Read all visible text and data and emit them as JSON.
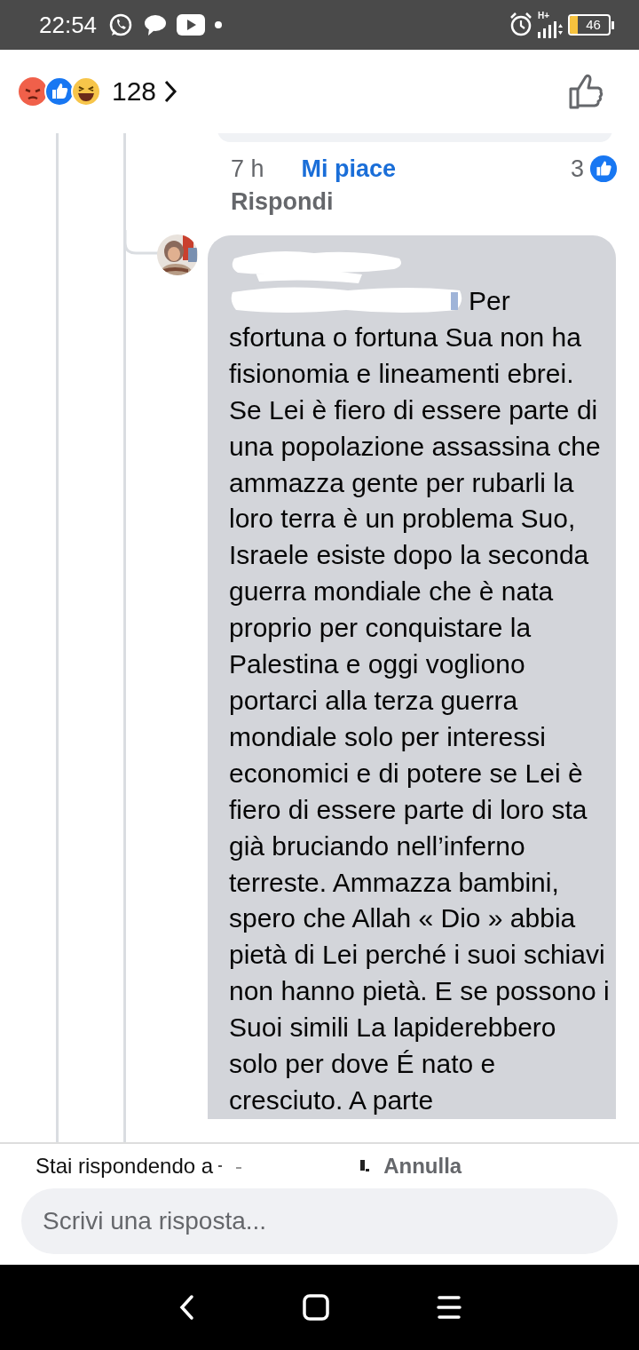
{
  "status_bar": {
    "time": "22:54",
    "network": "H+",
    "battery": "46"
  },
  "header": {
    "reaction_count": "128"
  },
  "previous_comment": {
    "time": "7 h",
    "like_action": "Mi piace",
    "reply_action": "Rispondi",
    "like_count": "3"
  },
  "reply": {
    "text": "Per sfortuna o fortuna Sua non ha fisionomia e lineamenti ebrei. Se Lei è fiero di essere parte di una popolazione assassina che ammazza gente per rubarli la loro terra è un problema Suo, Israele esiste dopo la seconda guerra mondiale che è nata proprio per conquistare la Palestina e oggi vogliono portarci alla terza guerra mondiale solo per interessi economici e di potere se Lei è fiero di essere parte di loro sta già bruciando nell’inferno terreste. Ammazza bambini, spero che Allah « Dio » abbia pietà di Lei perché i suoi schiavi non hanno pietà. E se possono i Suoi simili La lapiderebbero solo per dove É nato e cresciuto. A parte"
  },
  "composer": {
    "replying_to": "Stai rispondendo a",
    "cancel": "Annulla",
    "placeholder": "Scrivi una risposta..."
  }
}
